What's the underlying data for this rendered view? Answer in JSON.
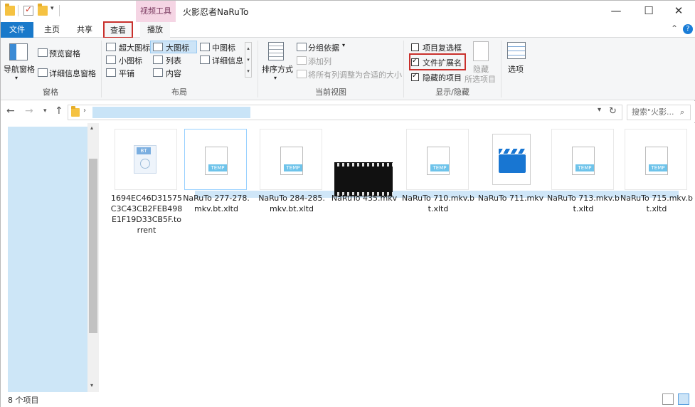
{
  "window": {
    "title": "火影忍者NaRuTo",
    "context_tab": "视频工具",
    "minimize": "—",
    "maximize": "☐",
    "close": "✕"
  },
  "tabs": {
    "file": "文件",
    "home": "主页",
    "share": "共享",
    "view": "查看",
    "play": "播放",
    "collapse": "⌃",
    "help": "?"
  },
  "ribbon": {
    "pane_group": {
      "label": "窗格",
      "nav_pane": "导航窗格",
      "preview_pane": "预览窗格",
      "details_pane": "详细信息窗格"
    },
    "layout_group": {
      "label": "布局",
      "extra_large": "超大图标",
      "large": "大图标",
      "medium": "中图标",
      "small": "小图标",
      "list": "列表",
      "details": "详细信息",
      "tiles": "平铺",
      "content": "内容"
    },
    "current_view_group": {
      "label": "当前视图",
      "sort_by": "排序方式",
      "group_by": "分组依据",
      "add_column": "添加列",
      "fit_columns": "将所有列调整为合适的大小"
    },
    "show_hide_group": {
      "label": "显示/隐藏",
      "item_checkboxes": "项目复选框",
      "file_extensions": "文件扩展名",
      "hidden_items": "隐藏的项目",
      "hide_selected_1": "隐藏",
      "hide_selected_2": "所选项目"
    },
    "options": "选项"
  },
  "address": {
    "search_placeholder": "搜索\"火影...",
    "search_icon": "magnifier-icon"
  },
  "files": [
    {
      "name": "1694EC46D31575C3C43CB2FEB498E1F19D33CB5F.torrent",
      "type": "torrent"
    },
    {
      "name": "NaRuTo 277-278.mkv.bt.xltd",
      "type": "temp",
      "selected": true
    },
    {
      "name": "NaRuTo 284-285.mkv.bt.xltd",
      "type": "temp"
    },
    {
      "name": "NaRuTo 435.mkv",
      "type": "video-thumb"
    },
    {
      "name": "NaRuTo 710.mkv.bt.xltd",
      "type": "temp"
    },
    {
      "name": "NaRuTo 711.mkv",
      "type": "video-icon"
    },
    {
      "name": "NaRuTo 713.mkv.bt.xltd",
      "type": "temp"
    },
    {
      "name": "NaRuTo 715.mkv.bt.xltd",
      "type": "temp"
    }
  ],
  "status": {
    "count": "8 个项目"
  },
  "colors": {
    "accent": "#1979ca",
    "highlight_red": "#c9302c",
    "context_tab": "#f5d5e4",
    "selection": "#cde6f7"
  }
}
